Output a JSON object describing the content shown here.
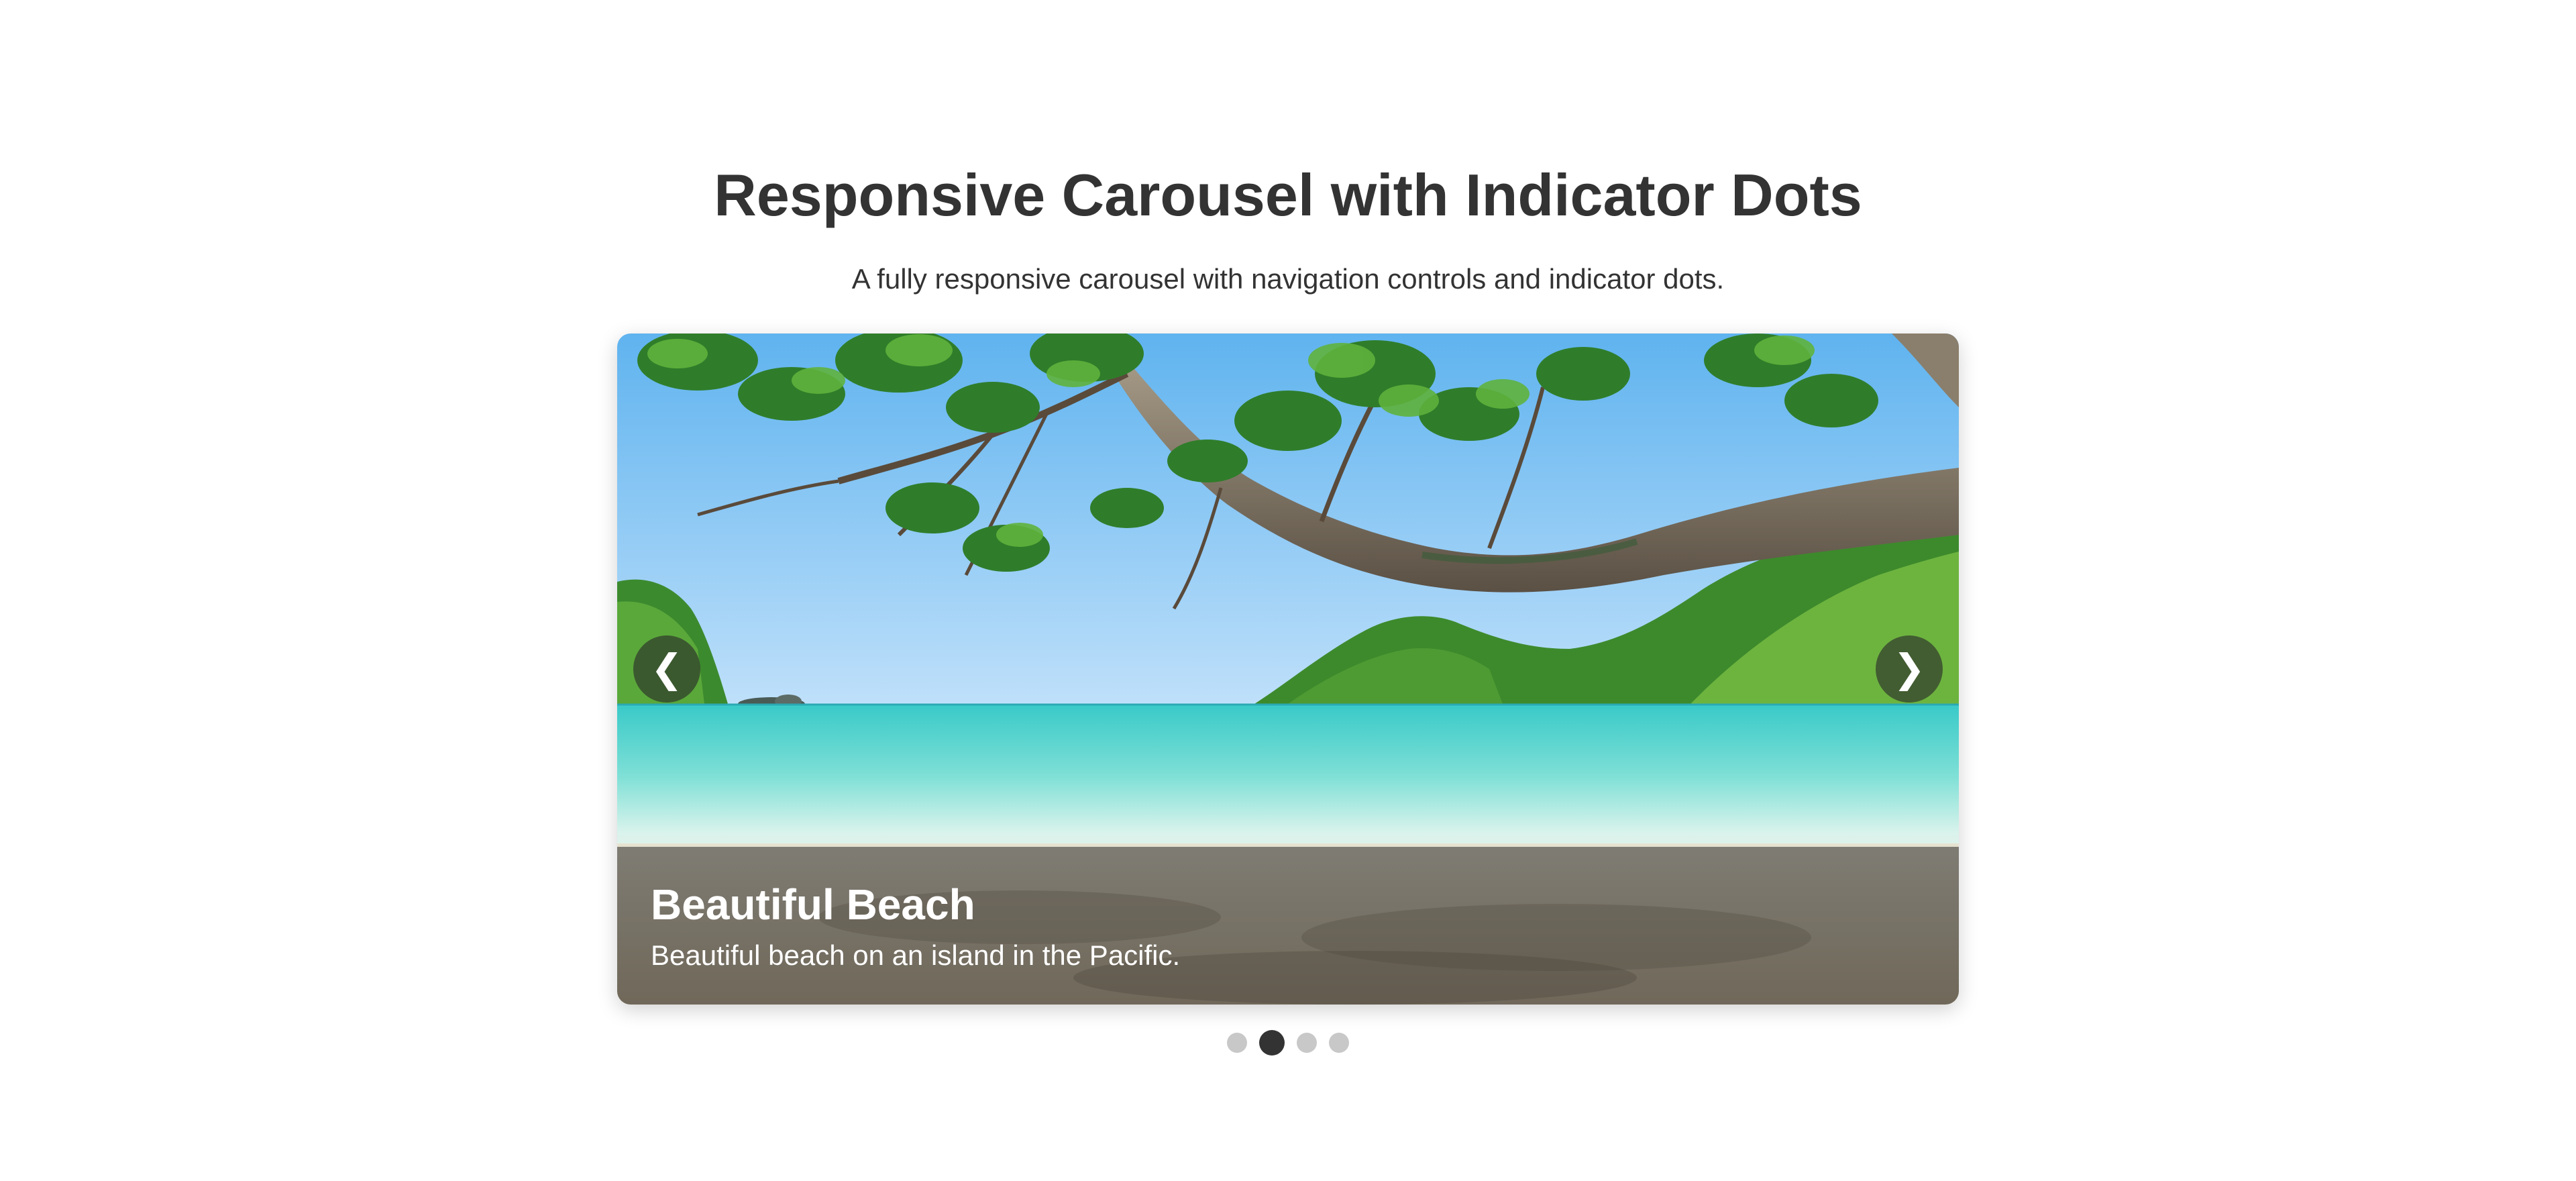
{
  "header": {
    "title": "Responsive Carousel with Indicator Dots",
    "subtitle": "A fully responsive carousel with navigation controls and indicator dots."
  },
  "carousel": {
    "prev_label": "❮",
    "next_label": "❯",
    "active_index": 1,
    "slide_count": 4,
    "current_slide": {
      "title": "Beautiful Beach",
      "description": "Beautiful beach on an island in the Pacific."
    }
  },
  "colors": {
    "text": "#333333",
    "dot_inactive": "#c8c8c8",
    "dot_active": "#333333"
  }
}
